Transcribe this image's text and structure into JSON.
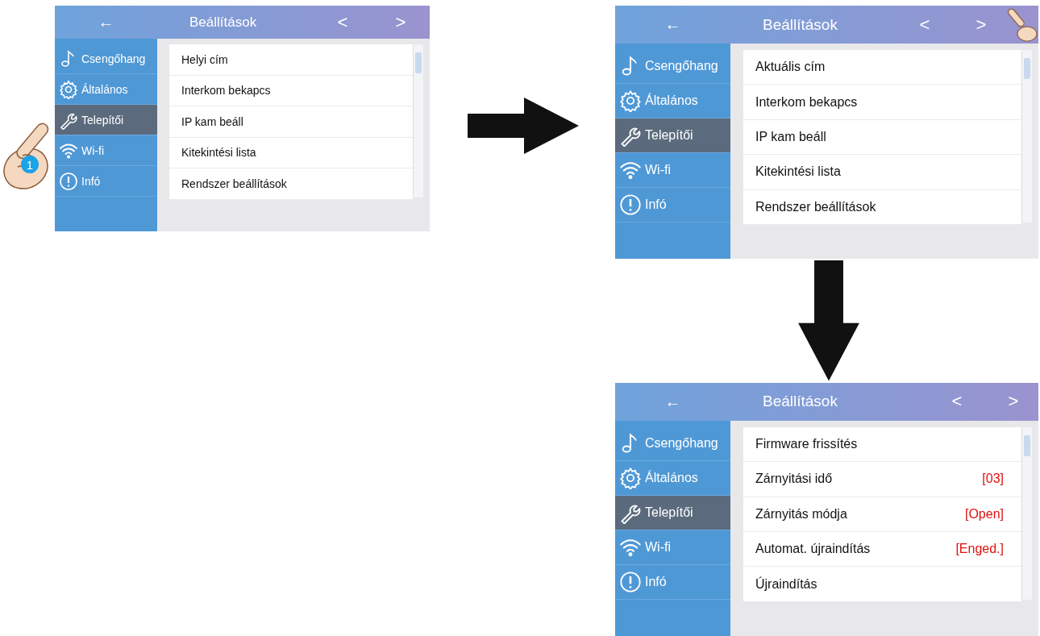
{
  "screens": [
    {
      "back": "←",
      "title": "Beállítások",
      "prev": "<",
      "next": ">",
      "step": "1",
      "menu": [
        {
          "label": "Csengőhang",
          "selected": false
        },
        {
          "label": "Általános",
          "selected": false
        },
        {
          "label": "Telepítői",
          "selected": true
        },
        {
          "label": "Wi-fi",
          "selected": false
        },
        {
          "label": "Infó",
          "selected": false
        }
      ],
      "rows": [
        {
          "label": "Helyi cím"
        },
        {
          "label": "Interkom bekapcs"
        },
        {
          "label": "IP kam beáll"
        },
        {
          "label": "Kitekintési lista"
        },
        {
          "label": "Rendszer beállítások"
        }
      ]
    },
    {
      "back": "←",
      "title": "Beállítások",
      "prev": "<",
      "next": ">",
      "menu": [
        {
          "label": "Csengőhang",
          "selected": false
        },
        {
          "label": "Általános",
          "selected": false
        },
        {
          "label": "Telepítői",
          "selected": true
        },
        {
          "label": "Wi-fi",
          "selected": false
        },
        {
          "label": "Infó",
          "selected": false
        }
      ],
      "rows": [
        {
          "label": "Aktuális cím"
        },
        {
          "label": "Interkom bekapcs"
        },
        {
          "label": "IP kam beáll"
        },
        {
          "label": "Kitekintési lista"
        },
        {
          "label": "Rendszer beállítások"
        }
      ]
    },
    {
      "back": "←",
      "title": "Beállítások",
      "prev": "<",
      "next": ">",
      "menu": [
        {
          "label": "Csengőhang",
          "selected": false
        },
        {
          "label": "Általános",
          "selected": false
        },
        {
          "label": "Telepítői",
          "selected": true
        },
        {
          "label": "Wi-fi",
          "selected": false
        },
        {
          "label": "Infó",
          "selected": false
        }
      ],
      "rows": [
        {
          "label": "Firmware frissítés"
        },
        {
          "label": "Zárnyitási idő",
          "value": "[03]"
        },
        {
          "label": "Zárnyitás módja",
          "value": "[Open]"
        },
        {
          "label": "Automat. újraindítás",
          "value": "[Enged.]"
        },
        {
          "label": "Újraindítás"
        }
      ]
    }
  ]
}
